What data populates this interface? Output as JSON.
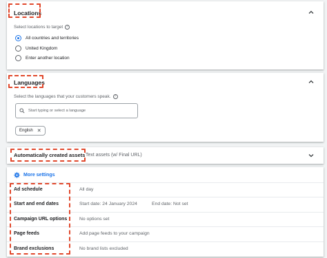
{
  "locations": {
    "title": "Locations",
    "prompt": "Select locations to target",
    "options": [
      {
        "label": "All countries and territories",
        "selected": true
      },
      {
        "label": "United Kingdom",
        "selected": false
      },
      {
        "label": "Enter another location",
        "selected": false
      }
    ]
  },
  "languages": {
    "title": "Languages",
    "prompt": "Select the languages that your customers speak.",
    "search_placeholder": "Start typing or select a language",
    "chip": "English"
  },
  "auto_assets": {
    "title": "Automatically created assets",
    "summary": "Text assets (w/ Final URL)"
  },
  "more_settings": {
    "label": "More settings",
    "rows": [
      {
        "label": "Ad schedule",
        "value": "All day",
        "value2": ""
      },
      {
        "label": "Start and end dates",
        "value": "Start date: 24 January 2024",
        "value2": "End date: Not set"
      },
      {
        "label": "Campaign URL options",
        "value": "No options set",
        "value2": ""
      },
      {
        "label": "Page feeds",
        "value": "Add page feeds to your campaign",
        "value2": ""
      },
      {
        "label": "Brand exclusions",
        "value": "No brand lists excluded",
        "value2": ""
      }
    ]
  },
  "colors": {
    "accent": "#1a73e8",
    "highlight": "#e0472b"
  }
}
